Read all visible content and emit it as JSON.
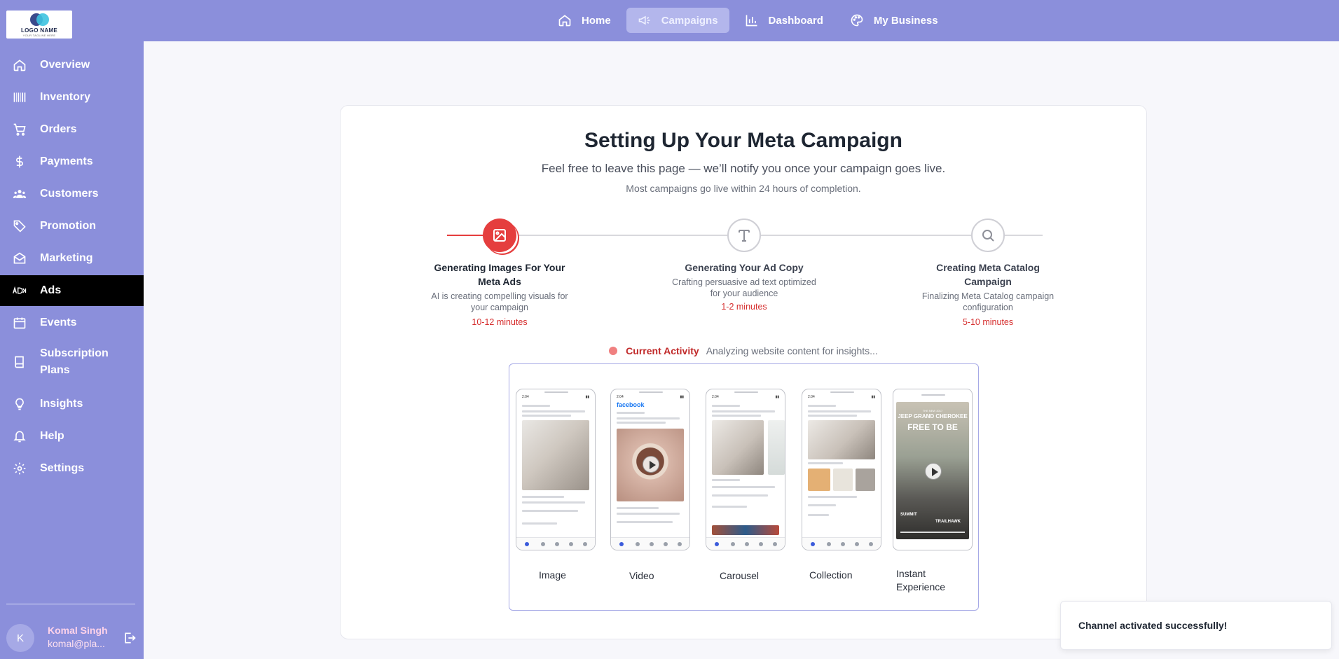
{
  "logo": {
    "name": "LOGO NAME",
    "tagline": "YOUR TAGLINE HERE"
  },
  "topnav": [
    {
      "label": "Home",
      "icon": "home-icon"
    },
    {
      "label": "Campaigns",
      "icon": "megaphone-icon",
      "active": true
    },
    {
      "label": "Dashboard",
      "icon": "bar-chart-icon"
    },
    {
      "label": "My Business",
      "icon": "palette-icon"
    }
  ],
  "sidebar": {
    "items": [
      {
        "label": "Overview",
        "icon": "home-icon"
      },
      {
        "label": "Inventory",
        "icon": "barcode-icon"
      },
      {
        "label": "Orders",
        "icon": "cart-icon"
      },
      {
        "label": "Payments",
        "icon": "dollar-icon"
      },
      {
        "label": "Customers",
        "icon": "users-icon"
      },
      {
        "label": "Promotion",
        "icon": "tag-icon"
      },
      {
        "label": "Marketing",
        "icon": "mail-icon"
      },
      {
        "label": "Ads",
        "icon": "ads-icon",
        "active": true
      },
      {
        "label": "Events",
        "icon": "calendar-icon"
      },
      {
        "label": "Subscription Plans",
        "icon": "book-icon"
      },
      {
        "label": "Insights",
        "icon": "bulb-icon"
      },
      {
        "label": "Help",
        "icon": "bell-icon"
      },
      {
        "label": "Settings",
        "icon": "gear-icon"
      }
    ],
    "user": {
      "initial": "K",
      "name": "Komal Singh",
      "email": "komal@pla..."
    }
  },
  "main": {
    "title": "Setting Up Your Meta Campaign",
    "subtitle": "Feel free to leave this page — we’ll notify you once your campaign goes live.",
    "note": "Most campaigns go live within 24 hours of completion.",
    "steps": [
      {
        "title": "Generating Images For Your Meta Ads",
        "desc": "AI is creating compelling visuals for your campaign",
        "time": "10-12 minutes",
        "icon": "image-icon",
        "active": true
      },
      {
        "title": "Generating Your Ad Copy",
        "desc": "Crafting persuasive ad text optimized for your audience",
        "time": "1-2 minutes",
        "icon": "text-icon"
      },
      {
        "title": "Creating Meta Catalog Campaign",
        "desc": "Finalizing Meta Catalog campaign configuration",
        "time": "5-10 minutes",
        "icon": "search-icon"
      }
    ],
    "activity": {
      "label": "Current Activity",
      "text": "Analyzing website content for insights..."
    },
    "formats": [
      "Image",
      "Video",
      "Carousel",
      "Collection",
      "Instant Experience"
    ],
    "phone_text": {
      "time": "2:04",
      "facebook": "facebook",
      "headline": "THE NEW 2017",
      "brand": "JEEP GRAND CHEROKEE",
      "slogan": "FREE TO BE",
      "summit": "SUMMIT",
      "trailhawk": "TRAILHAWK"
    }
  },
  "toast": {
    "message": "Channel activated successfully!"
  },
  "colors": {
    "brand": "#8b8fdb",
    "accent": "#e53e3e",
    "active_nav": "#000000"
  }
}
